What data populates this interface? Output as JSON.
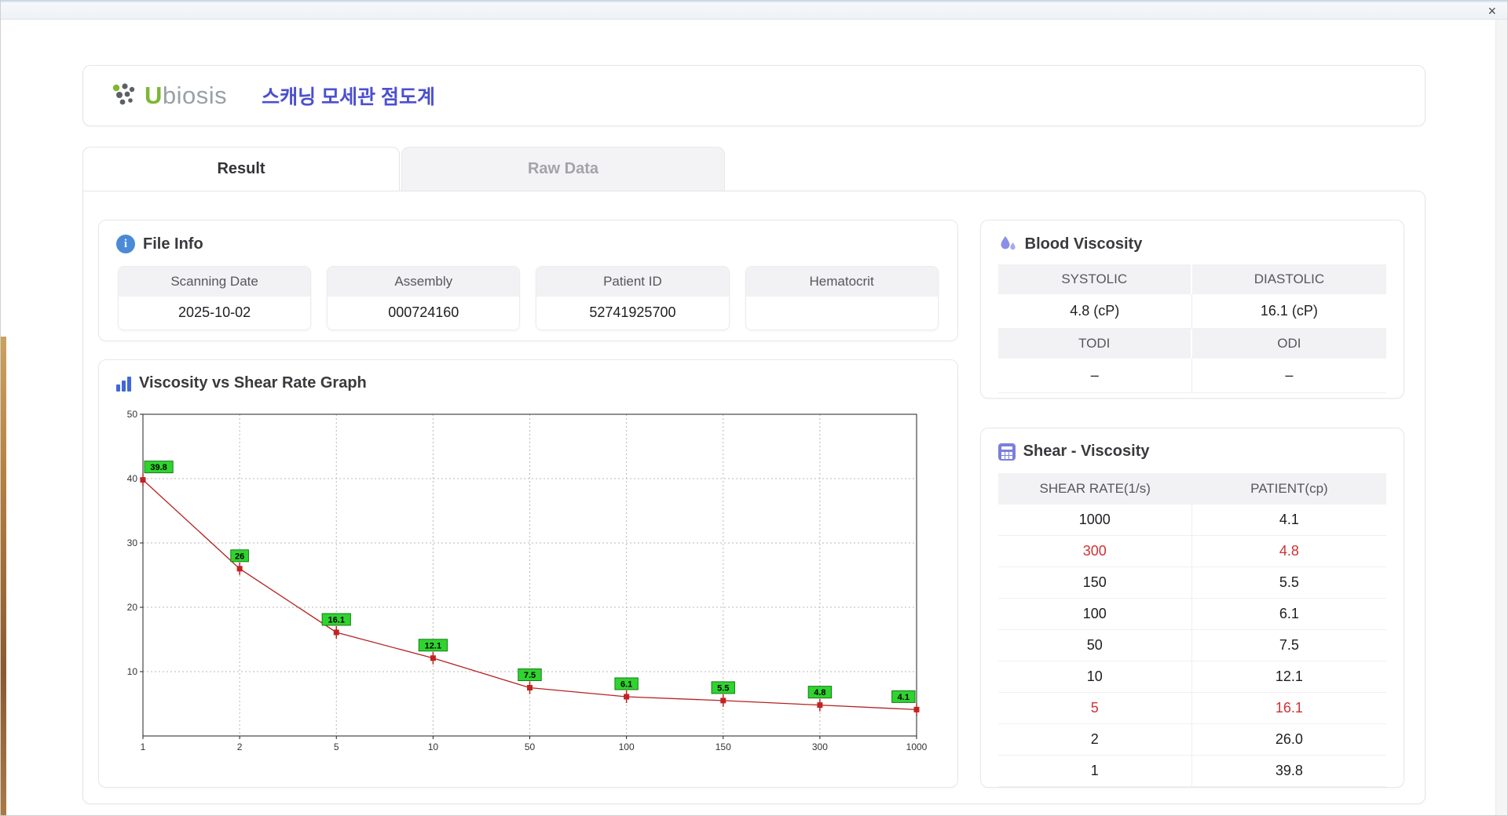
{
  "window": {
    "close": "×"
  },
  "header": {
    "brand_u": "U",
    "brand_rest": "biosis",
    "title": "스캐닝 모세관 점도계"
  },
  "tabs": [
    {
      "label": "Result",
      "active": true
    },
    {
      "label": "Raw Data",
      "active": false
    }
  ],
  "file_info": {
    "title": "File Info",
    "fields": [
      {
        "label": "Scanning Date",
        "value": "2025-10-02"
      },
      {
        "label": "Assembly",
        "value": "000724160"
      },
      {
        "label": "Patient ID",
        "value": "52741925700"
      },
      {
        "label": "Hematocrit",
        "value": ""
      }
    ]
  },
  "graph": {
    "title": "Viscosity vs Shear Rate Graph"
  },
  "chart_data": {
    "type": "line",
    "title": "Viscosity vs Shear Rate Graph",
    "x": [
      1,
      2,
      5,
      10,
      50,
      100,
      150,
      300,
      1000
    ],
    "values": [
      39.8,
      26,
      16.1,
      12.1,
      7.5,
      6.1,
      5.5,
      4.8,
      4.1
    ],
    "labels": [
      "39.8",
      "26",
      "16.1",
      "12.1",
      "7.5",
      "6.1",
      "5.5",
      "4.8",
      "4.1"
    ],
    "x_ticks": [
      "1",
      "2",
      "5",
      "10",
      "50",
      "100",
      "150",
      "300",
      "1000"
    ],
    "y_ticks": [
      10,
      20,
      30,
      40,
      50
    ],
    "ylim": [
      0,
      50
    ],
    "xscale": "log-categorical",
    "grid": "dotted",
    "line_color": "#b52222",
    "marker_color": "#c22222",
    "label_bg": "#2fd42f",
    "label_border": "#157a15"
  },
  "blood_viscosity": {
    "title": "Blood Viscosity",
    "cells": [
      {
        "label": "SYSTOLIC",
        "value": "4.8 (cP)"
      },
      {
        "label": "DIASTOLIC",
        "value": "16.1 (cP)"
      },
      {
        "label": "TODI",
        "value": "–"
      },
      {
        "label": "ODI",
        "value": "–"
      }
    ]
  },
  "shear_viscosity": {
    "title": "Shear - Viscosity",
    "columns": [
      "SHEAR RATE(1/s)",
      "PATIENT(cp)"
    ],
    "rows": [
      {
        "rate": "1000",
        "value": "4.1",
        "highlight": false
      },
      {
        "rate": "300",
        "value": "4.8",
        "highlight": true
      },
      {
        "rate": "150",
        "value": "5.5",
        "highlight": false
      },
      {
        "rate": "100",
        "value": "6.1",
        "highlight": false
      },
      {
        "rate": "50",
        "value": "7.5",
        "highlight": false
      },
      {
        "rate": "10",
        "value": "12.1",
        "highlight": false
      },
      {
        "rate": "5",
        "value": "16.1",
        "highlight": true
      },
      {
        "rate": "2",
        "value": "26.0",
        "highlight": false
      },
      {
        "rate": "1",
        "value": "39.8",
        "highlight": false
      }
    ]
  }
}
